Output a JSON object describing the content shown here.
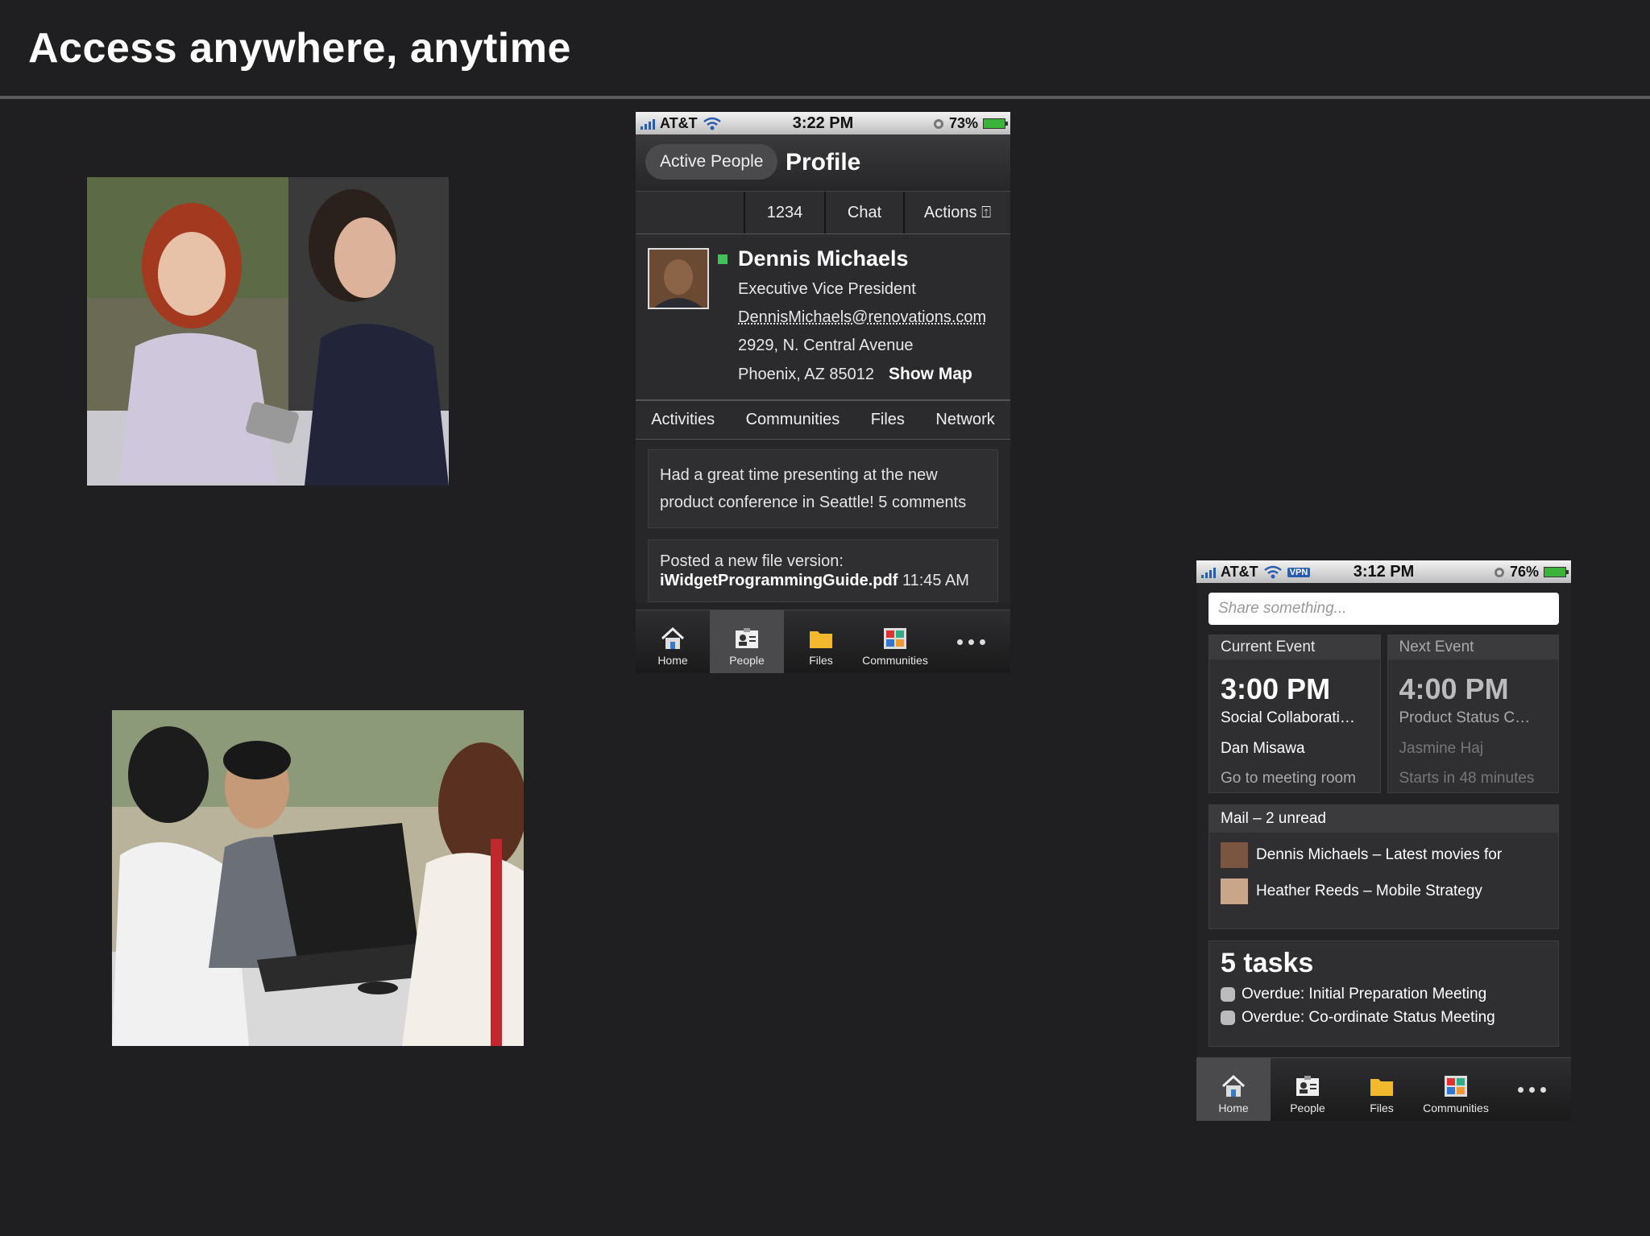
{
  "slide": {
    "title": "Access anywhere, anytime"
  },
  "phone1": {
    "status": {
      "carrier": "AT&T",
      "time": "3:22 PM",
      "battery": "73%"
    },
    "nav": {
      "back": "Active People",
      "title": "Profile"
    },
    "segments": [
      "1234",
      "Chat",
      "Actions ⍐"
    ],
    "profile": {
      "name": "Dennis Michaels",
      "title": "Executive Vice President",
      "email": "DennisMichaels@renovations.com",
      "address1": "2929, N. Central Avenue",
      "address2": "Phoenix, AZ 85012",
      "show_map": "Show Map"
    },
    "tabs": [
      "Activities",
      "Communities",
      "Files",
      "Network"
    ],
    "feed": {
      "post1": "Had a great time presenting at the new product conference in Seattle! 5 comments",
      "post2_prefix": "Posted a new file version:",
      "post2_file": "iWidgetProgrammingGuide.pdf",
      "post2_time": "11:45 AM"
    },
    "tabbar": [
      "Home",
      "People",
      "Files",
      "Communities"
    ],
    "tabbar_active": "People"
  },
  "phone2": {
    "status": {
      "carrier": "AT&T",
      "vpn": "VPN",
      "time": "3:12 PM",
      "battery": "76%"
    },
    "share_placeholder": "Share something...",
    "current": {
      "header": "Current Event",
      "time": "3:00 PM",
      "title": "Social Collaborati…",
      "person": "Dan Misawa",
      "action": "Go to meeting room"
    },
    "next": {
      "header": "Next Event",
      "time": "4:00 PM",
      "title": "Product Status C…",
      "person": "Jasmine Haj",
      "action": "Starts in 48 minutes"
    },
    "mail": {
      "header": "Mail – 2 unread",
      "items": [
        "Dennis Michaels – Latest movies for",
        "Heather Reeds – Mobile Strategy"
      ]
    },
    "tasks": {
      "header": "5 tasks",
      "items": [
        "Overdue: Initial Preparation Meeting",
        "Overdue: Co-ordinate Status Meeting"
      ]
    },
    "tabbar": [
      "Home",
      "People",
      "Files",
      "Communities"
    ],
    "tabbar_active": "Home"
  },
  "colors": {
    "background": "#1f1f21",
    "presence": "#3fc35a",
    "signal": "#2a5db0"
  }
}
